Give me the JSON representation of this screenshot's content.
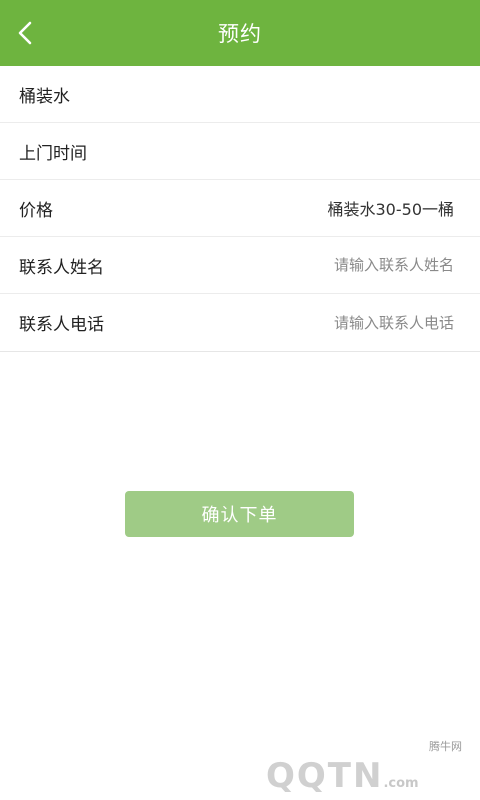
{
  "header": {
    "title": "预约",
    "back_icon": "chevron-left-icon",
    "color": "#6eb43f"
  },
  "form": {
    "rows": [
      {
        "label": "桶装水"
      },
      {
        "label": "上门时间"
      },
      {
        "label": "价格",
        "value": "桶装水30-50一桶"
      },
      {
        "label": "联系人姓名",
        "placeholder": "请输入联系人姓名"
      },
      {
        "label": "联系人电话",
        "placeholder": "请输入联系人电话"
      }
    ]
  },
  "submit": {
    "label": "确认下单",
    "color": "#9fcb86"
  },
  "watermark": {
    "site_name": "腾牛网",
    "logo_text": "QQTN",
    "logo_suffix": ".com"
  }
}
